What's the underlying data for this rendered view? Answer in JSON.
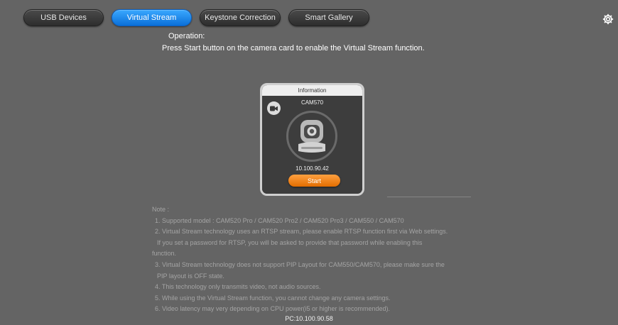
{
  "tabs": [
    {
      "label": "USB Devices",
      "active": false
    },
    {
      "label": "Virtual Stream",
      "active": true
    },
    {
      "label": "Keystone Correction",
      "active": false
    },
    {
      "label": "Smart Gallery",
      "active": false
    }
  ],
  "settings_icon": "gear-icon",
  "operation": {
    "title": "Operation:",
    "text": "Press Start button on the camera card to enable the Virtual Stream function."
  },
  "card": {
    "header": "Information",
    "model": "CAM570",
    "ip": "10.100.90.42",
    "start_label": "Start",
    "camera_icon": "video-camera-icon"
  },
  "notes": {
    "title": "Note :",
    "lines": [
      "1. Supported model : CAM520 Pro / CAM520 Pro2 / CAM520 Pro3 / CAM550 / CAM570",
      "2. Virtual Stream technology uses an RTSP stream, please enable RTSP function first via Web settings.",
      "   If you set a password for RTSP, you will be asked to provide that password while enabling this",
      "function.",
      "3. Virtual Stream technology does not support PIP Layout for CAM550/CAM570, please make sure the",
      "   PIP layout is OFF state.",
      "4. This technology only transmits video, not audio sources.",
      "5. While using the Virtual Stream function, you cannot change any camera settings.",
      "6. Video latency may very depending on CPU power(i5 or higher is recommended)."
    ]
  },
  "footer": {
    "pc": "PC:10.100.90.58"
  },
  "colors": {
    "background": "#646464",
    "active_tab": "#1a86f0",
    "start_button": "#f28a1c"
  }
}
